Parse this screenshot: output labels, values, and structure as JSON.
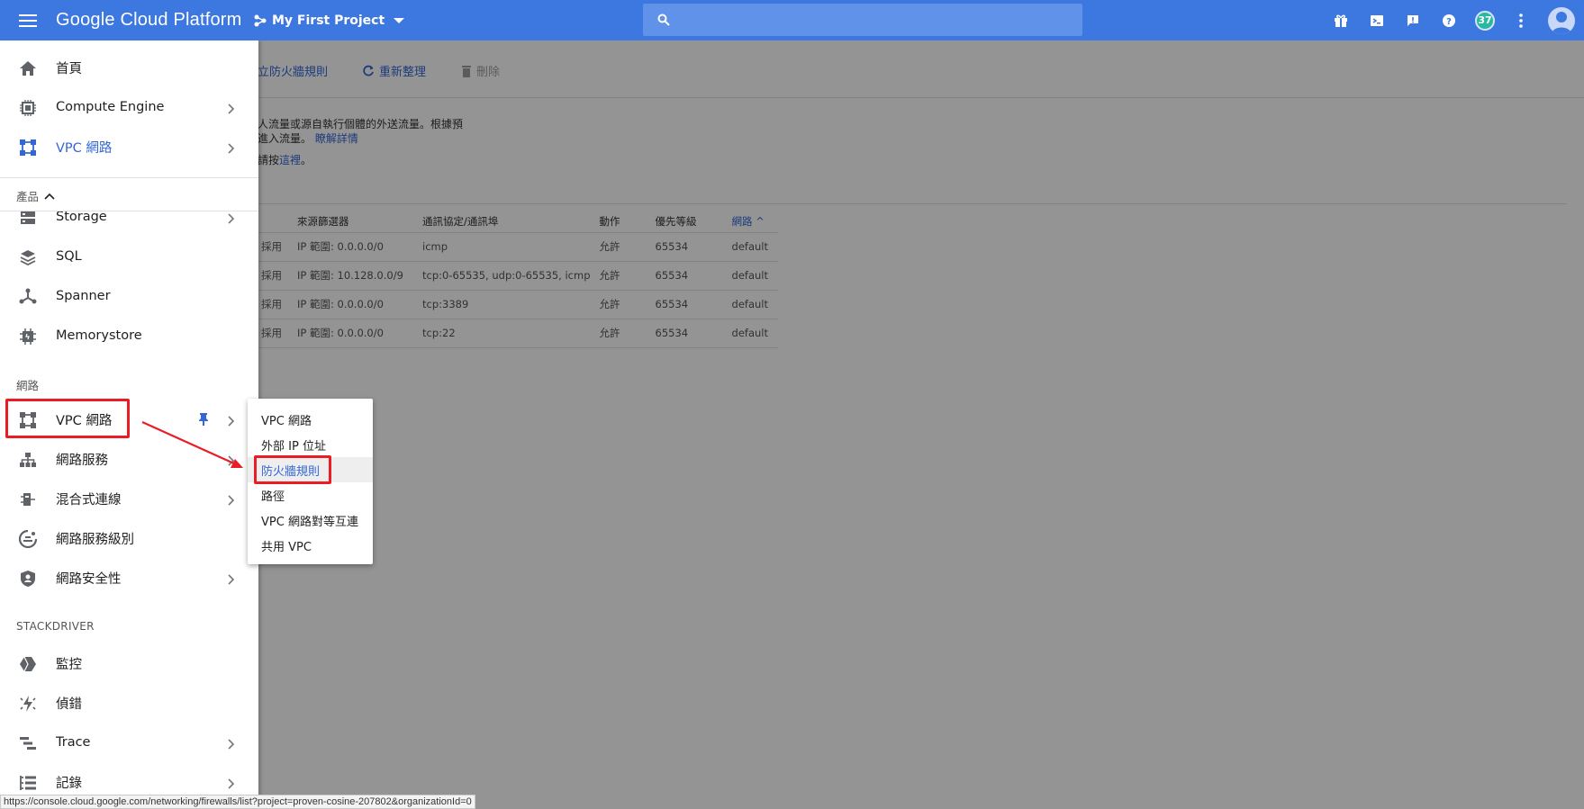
{
  "topbar": {
    "product_title": "Google Cloud Platform",
    "project_name": "My First Project",
    "search_placeholder": "",
    "notification_count": "37",
    "icons": [
      "gift-icon",
      "cloud-shell-icon",
      "feedback-icon",
      "help-icon",
      "notifications-icon",
      "more-vert-icon",
      "account-icon"
    ],
    "colors": {
      "bar": "#3d78e0",
      "search": "#5f92e8",
      "badge": "#29b8a0"
    }
  },
  "page": {
    "toolbar": {
      "create_label": "立防火牆規則",
      "refresh_label": "重新整理",
      "delete_label": "刪除"
    },
    "description": {
      "line1": "人流量或源自執行個體的外送流量。根據預",
      "line2_text": "進入流量。",
      "line2_link": "瞭解詳情",
      "line3_text": "請按",
      "line3_link": "這裡",
      "line3_end": "。"
    },
    "table": {
      "headers": [
        "",
        "來源篩選器",
        "通訊協定/通訊埠",
        "動作",
        "優先等級",
        "網路 ^"
      ],
      "rows": [
        [
          "採用",
          "IP 範圍: 0.0.0.0/0",
          "icmp",
          "允許",
          "65534",
          "default"
        ],
        [
          "採用",
          "IP 範圍: 10.128.0.0/9",
          "tcp:0-65535, udp:0-65535, icmp",
          "允許",
          "65534",
          "default"
        ],
        [
          "採用",
          "IP 範圍: 0.0.0.0/0",
          "tcp:3389",
          "允許",
          "65534",
          "default"
        ],
        [
          "採用",
          "IP 範圍: 0.0.0.0/0",
          "tcp:22",
          "允許",
          "65534",
          "default"
        ]
      ]
    }
  },
  "drawer": {
    "pinned": [
      {
        "label": "首頁",
        "icon": "home-icon",
        "chevron": false,
        "active": false
      },
      {
        "label": "Compute Engine",
        "icon": "compute-engine-icon",
        "chevron": true,
        "active": false
      },
      {
        "label": "VPC 網路",
        "icon": "vpc-network-icon",
        "chevron": true,
        "active": true
      }
    ],
    "products_label": "產品",
    "storage_items": [
      {
        "label": "Storage",
        "icon": "storage-icon",
        "chevron": true
      },
      {
        "label": "SQL",
        "icon": "sql-icon",
        "chevron": false
      },
      {
        "label": "Spanner",
        "icon": "spanner-icon",
        "chevron": false
      },
      {
        "label": "Memorystore",
        "icon": "memorystore-icon",
        "chevron": false
      }
    ],
    "network_section_label": "網路",
    "network_items": [
      {
        "label": "VPC 網路",
        "icon": "vpc-network-icon",
        "chevron": true,
        "pinned": true
      },
      {
        "label": "網路服務",
        "icon": "network-services-icon",
        "chevron": true
      },
      {
        "label": "混合式連線",
        "icon": "hybrid-connectivity-icon",
        "chevron": true
      },
      {
        "label": "網路服務級別",
        "icon": "network-tiers-icon",
        "chevron": false
      },
      {
        "label": "網路安全性",
        "icon": "network-security-icon",
        "chevron": true
      }
    ],
    "stackdriver_label": "STACKDRIVER",
    "stackdriver_items": [
      {
        "label": "監控",
        "icon": "monitoring-icon",
        "chevron": false
      },
      {
        "label": "偵錯",
        "icon": "debugger-icon",
        "chevron": false
      },
      {
        "label": "Trace",
        "icon": "trace-icon",
        "chevron": true
      },
      {
        "label": "記錄",
        "icon": "logging-icon",
        "chevron": true
      }
    ]
  },
  "submenu": {
    "items": [
      {
        "label": "VPC 網路",
        "selected": false
      },
      {
        "label": "外部 IP 位址",
        "selected": false
      },
      {
        "label": "防火牆規則",
        "selected": true
      },
      {
        "label": "路徑",
        "selected": false
      },
      {
        "label": "VPC 網路對等互連",
        "selected": false
      },
      {
        "label": "共用 VPC",
        "selected": false
      }
    ]
  },
  "status_bar": {
    "url": "https://console.cloud.google.com/networking/firewalls/list?project=proven-cosine-207802&organizationId=0"
  },
  "annotation": {
    "highlight_color": "#ea1d24"
  }
}
